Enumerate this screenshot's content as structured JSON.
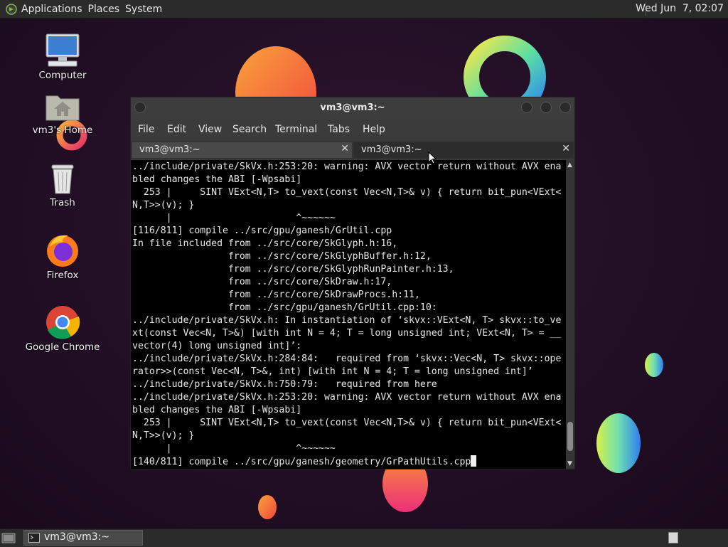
{
  "top_panel": {
    "menus": [
      "Applications",
      "Places",
      "System"
    ],
    "clock": "Wed Jun  7, 02:07"
  },
  "desktop_icons": [
    {
      "label": "Computer",
      "icon": "computer-icon"
    },
    {
      "label": "vm3's Home",
      "icon": "home-folder-icon"
    },
    {
      "label": "Trash",
      "icon": "trash-icon"
    },
    {
      "label": "Firefox",
      "icon": "firefox-icon"
    },
    {
      "label": "Google Chrome",
      "icon": "chrome-icon"
    }
  ],
  "terminal": {
    "title": "vm3@vm3:~",
    "menu": [
      "File",
      "Edit",
      "View",
      "Search",
      "Terminal",
      "Tabs",
      "Help"
    ],
    "tabs": [
      {
        "label": "vm3@vm3:~",
        "active": true
      },
      {
        "label": "vm3@vm3:~",
        "active": false
      }
    ],
    "lines": [
      "../include/private/SkVx.h:253:20: warning: AVX vector return without AVX ena",
      "bled changes the ABI [-Wpsabi]",
      "  253 |     SINT VExt<N,T> to_vext(const Vec<N,T>& v) { return bit_pun<VExt<",
      "N,T>>(v); }",
      "      |                      ^~~~~~~",
      "[116/811] compile ../src/gpu/ganesh/GrUtil.cpp",
      "In file included from ../src/core/SkGlyph.h:16,",
      "                 from ../src/core/SkGlyphBuffer.h:12,",
      "                 from ../src/core/SkGlyphRunPainter.h:13,",
      "                 from ../src/core/SkDraw.h:17,",
      "                 from ../src/core/SkDrawProcs.h:11,",
      "                 from ../src/gpu/ganesh/GrUtil.cpp:10:",
      "../include/private/SkVx.h: In instantiation of ‘skvx::VExt<N, T> skvx::to_ve",
      "xt(const Vec<N, T>&) [with int N = 4; T = long unsigned int; VExt<N, T> = __",
      "vector(4) long unsigned int]’:",
      "../include/private/SkVx.h:284:84:   required from ‘skvx::Vec<N, T> skvx::ope",
      "rator>>(const Vec<N, T>&, int) [with int N = 4; T = long unsigned int]’",
      "../include/private/SkVx.h:750:79:   required from here",
      "../include/private/SkVx.h:253:20: warning: AVX vector return without AVX ena",
      "bled changes the ABI [-Wpsabi]",
      "  253 |     SINT VExt<N,T> to_vext(const Vec<N,T>& v) { return bit_pun<VExt<",
      "N,T>>(v); }",
      "      |                      ^~~~~~~",
      "[140/811] compile ../src/gpu/ganesh/geometry/GrPathUtils.cpp"
    ],
    "scroll_position": 0.97,
    "scroll_visible_fraction": 0.1
  },
  "taskbar": {
    "window_button": "vm3@vm3:~"
  },
  "colors": {
    "panel": "#2b2b2b",
    "terminal_bg": "#000000",
    "terminal_fg": "#e6e6e6"
  }
}
